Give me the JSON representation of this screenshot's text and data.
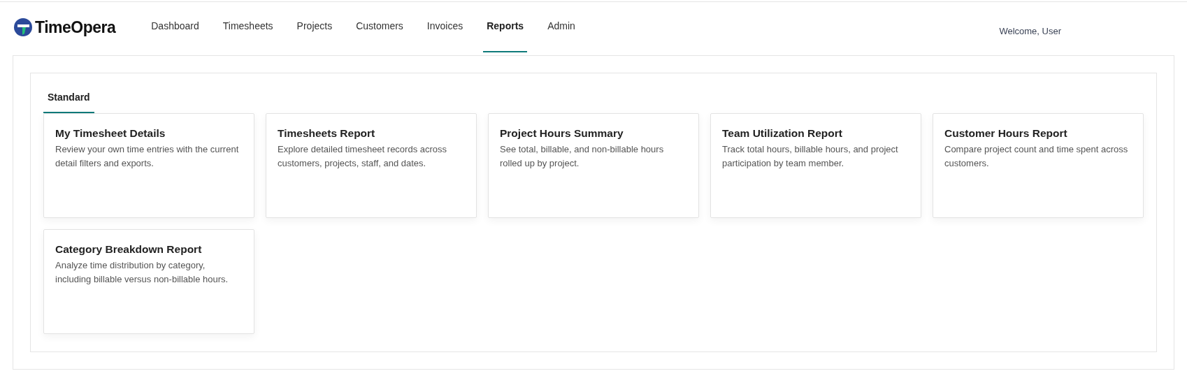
{
  "brand": {
    "name": "TimeOpera"
  },
  "nav": [
    {
      "label": "Dashboard",
      "selected": false
    },
    {
      "label": "Timesheets",
      "selected": false
    },
    {
      "label": "Projects",
      "selected": false
    },
    {
      "label": "Customers",
      "selected": false
    },
    {
      "label": "Invoices",
      "selected": false
    },
    {
      "label": "Reports",
      "selected": true
    },
    {
      "label": "Admin",
      "selected": false
    }
  ],
  "welcome": "Welcome, User",
  "tabs": [
    {
      "label": "Standard",
      "selected": true
    }
  ],
  "reports": [
    {
      "title": "My Timesheet Details",
      "description": "Review your own time entries with the current detail filters and exports."
    },
    {
      "title": "Timesheets Report",
      "description": "Explore detailed timesheet records across customers, projects, staff, and dates."
    },
    {
      "title": "Project Hours Summary",
      "description": "See total, billable, and non-billable hours rolled up by project."
    },
    {
      "title": "Team Utilization Report",
      "description": "Track total hours, billable hours, and project participation by team member."
    },
    {
      "title": "Customer Hours Report",
      "description": "Compare project count and time spent across customers."
    },
    {
      "title": "Category Breakdown Report",
      "description": "Analyze time distribution by category, including billable versus non-billable hours."
    }
  ]
}
